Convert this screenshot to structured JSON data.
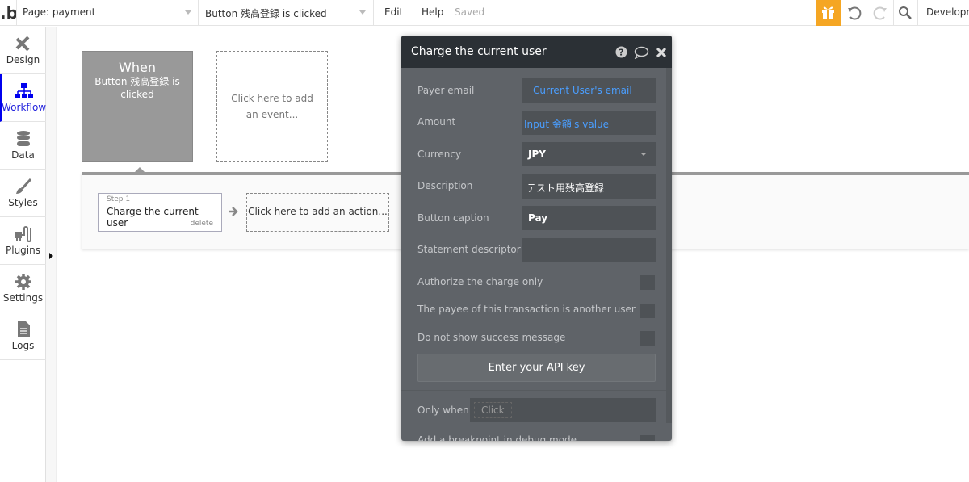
{
  "topbar": {
    "logo": ".b",
    "page_select": "Page: payment",
    "event_select": "Button 残高登録 is clicked",
    "edit": "Edit",
    "help": "Help",
    "saved": "Saved",
    "environment": "Developm",
    "accent": "#f5a623"
  },
  "sidebar": {
    "items": [
      {
        "label": "Design",
        "icon": "design-icon"
      },
      {
        "label": "Workflow",
        "icon": "workflow-icon",
        "active": true
      },
      {
        "label": "Data",
        "icon": "database-icon"
      },
      {
        "label": "Styles",
        "icon": "brush-icon"
      },
      {
        "label": "Plugins",
        "icon": "plug-icon"
      },
      {
        "label": "Settings",
        "icon": "gear-icon"
      },
      {
        "label": "Logs",
        "icon": "document-icon"
      }
    ]
  },
  "canvas": {
    "event_title": "When",
    "event_desc": "Button 残高登録 is clicked",
    "add_event": "Click here to add an event...",
    "step_label": "Step 1",
    "step_name": "Charge the current user",
    "step_delete": "delete",
    "add_action": "Click here to add an action..."
  },
  "popup": {
    "title": "Charge the current user",
    "fields": [
      {
        "label": "Payer email",
        "value": "Current User's email"
      },
      {
        "label": "Amount",
        "value": "Input 金額's value"
      },
      {
        "label": "Currency",
        "value": "JPY"
      },
      {
        "label": "Description",
        "value": "テスト用残高登録"
      },
      {
        "label": "Button caption",
        "value": "Pay"
      },
      {
        "label": "Statement descriptor",
        "value": ""
      }
    ],
    "checkboxes": [
      {
        "label": "Authorize the charge only",
        "checked": false
      },
      {
        "label": "The payee of this transaction is another user",
        "checked": false
      },
      {
        "label": "Do not show success message",
        "checked": false
      }
    ],
    "api_button": "Enter your API key",
    "only_when": "Only when",
    "only_when_placeholder": "Click",
    "breakpoint": "Add a breakpoint in debug mode",
    "link_color": "#4a9eff"
  }
}
